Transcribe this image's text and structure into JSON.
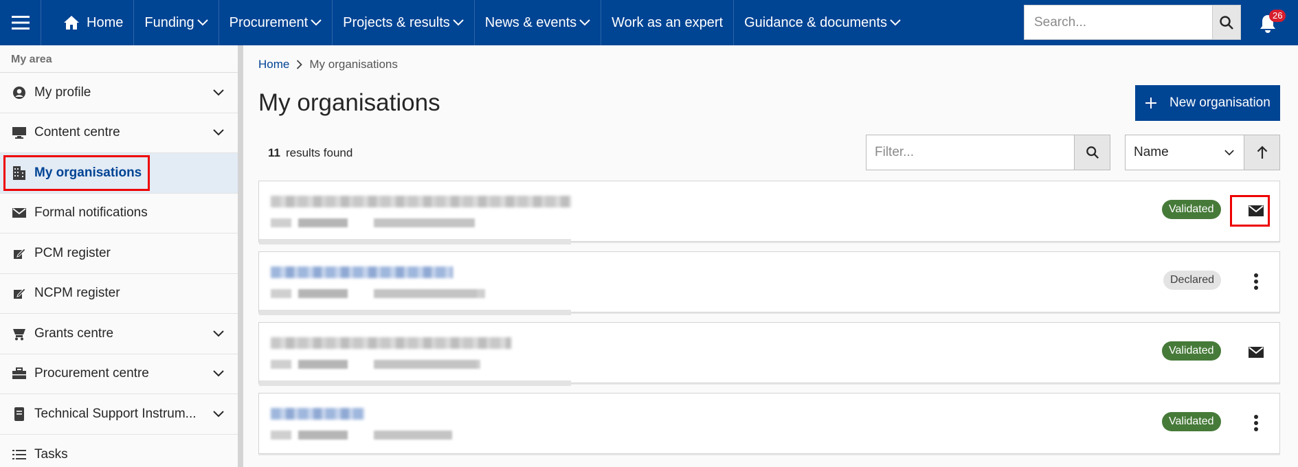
{
  "topnav": {
    "items": [
      {
        "label": "Home",
        "icon": "home-icon",
        "dropdown": false
      },
      {
        "label": "Funding",
        "dropdown": true
      },
      {
        "label": "Procurement",
        "dropdown": true
      },
      {
        "label": "Projects & results",
        "dropdown": true
      },
      {
        "label": "News & events",
        "dropdown": true
      },
      {
        "label": "Work as an expert",
        "dropdown": false
      },
      {
        "label": "Guidance & documents",
        "dropdown": true
      }
    ],
    "search_placeholder": "Search...",
    "notification_count": "26"
  },
  "sidebar": {
    "section_title": "My area",
    "items": [
      {
        "label": "My profile",
        "icon": "user-circle-icon",
        "expandable": true
      },
      {
        "label": "Content centre",
        "icon": "monitor-icon",
        "expandable": true
      },
      {
        "label": "My organisations",
        "icon": "building-icon",
        "expandable": false,
        "active": true
      },
      {
        "label": "Formal notifications",
        "icon": "envelope-icon",
        "expandable": false
      },
      {
        "label": "PCM register",
        "icon": "edit-icon",
        "expandable": false
      },
      {
        "label": "NCPM register",
        "icon": "edit-icon",
        "expandable": false
      },
      {
        "label": "Grants centre",
        "icon": "grant-icon",
        "expandable": true
      },
      {
        "label": "Procurement centre",
        "icon": "briefcase-icon",
        "expandable": true
      },
      {
        "label": "Technical Support Instrum...",
        "icon": "document-icon",
        "expandable": true
      },
      {
        "label": "Tasks",
        "icon": "list-icon",
        "expandable": false
      }
    ]
  },
  "breadcrumb": {
    "home": "Home",
    "current": "My organisations"
  },
  "page": {
    "title": "My organisations",
    "new_button_label": "New organisation",
    "results_count": "11",
    "results_label": "results found",
    "filter_placeholder": "Filter...",
    "sort_value": "Name",
    "sort_direction": "ascending"
  },
  "organisations": [
    {
      "status": "Validated",
      "action": "message",
      "name_blurred": true
    },
    {
      "status": "Declared",
      "action": "more",
      "name_blurred": true
    },
    {
      "status": "Validated",
      "action": "message",
      "name_blurred": true
    },
    {
      "status": "Validated",
      "action": "more",
      "name_blurred": true
    }
  ],
  "colors": {
    "brand": "#004494",
    "validated": "#467a39",
    "declared": "#e3e3e3",
    "badge_red": "#d81e2d",
    "highlight": "#e00000"
  }
}
